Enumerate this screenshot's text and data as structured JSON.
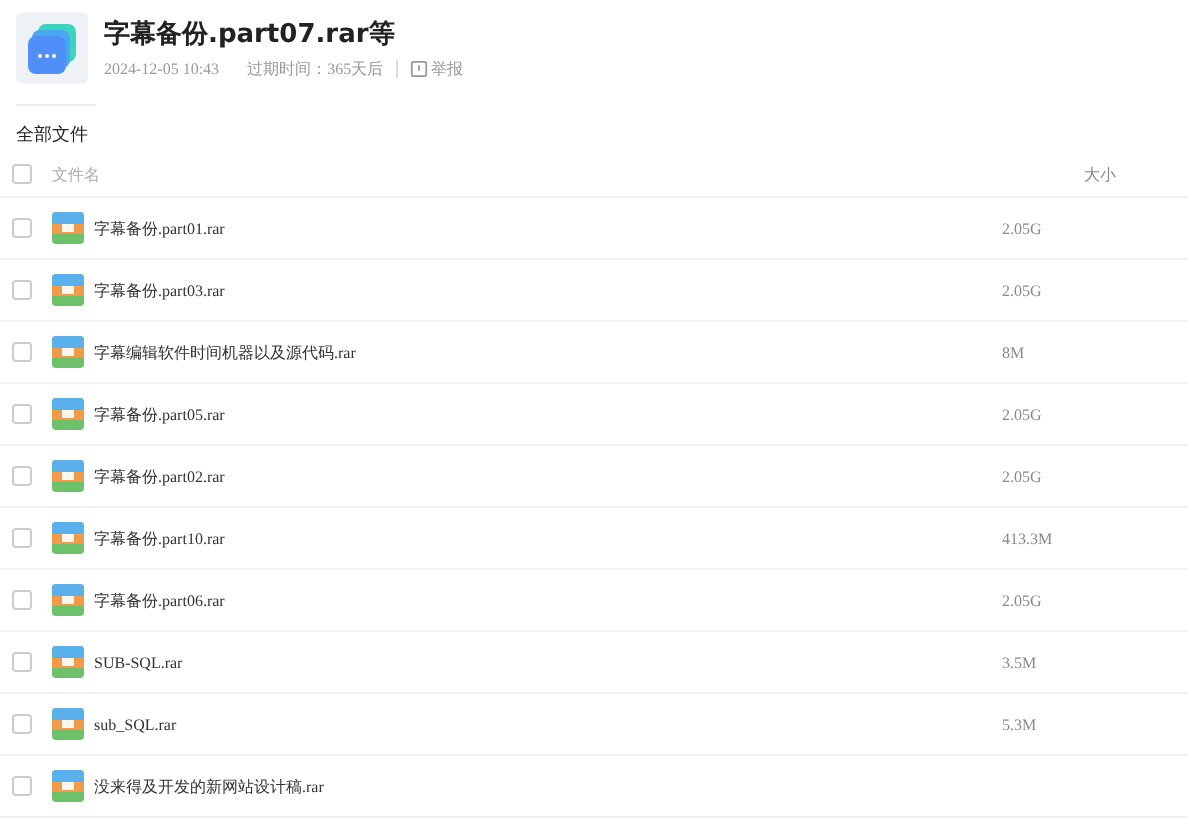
{
  "share": {
    "title": "字幕备份.part07.rar等",
    "date": "2024-12-05 10:43",
    "expiry": "过期时间：365天后",
    "report": "举报"
  },
  "breadcrumb": "全部文件",
  "table": {
    "columns": [
      "文件名",
      "大小"
    ],
    "header_checked": false,
    "rows": [
      {
        "name": "字幕备份.part01.rar",
        "size": "2.05G",
        "checked": false
      },
      {
        "name": "字幕备份.part03.rar",
        "size": "2.05G",
        "checked": false
      },
      {
        "name": "字幕编辑软件时间机器以及源代码.rar",
        "size": "8M",
        "checked": false
      },
      {
        "name": "字幕备份.part05.rar",
        "size": "2.05G",
        "checked": false
      },
      {
        "name": "字幕备份.part02.rar",
        "size": "2.05G",
        "checked": false
      },
      {
        "name": "字幕备份.part10.rar",
        "size": "413.3M",
        "checked": false
      },
      {
        "name": "字幕备份.part06.rar",
        "size": "2.05G",
        "checked": false
      },
      {
        "name": "SUB-SQL.rar",
        "size": "3.5M",
        "checked": false
      },
      {
        "name": "sub_SQL.rar",
        "size": "5.3M",
        "checked": false
      },
      {
        "name": "没来得及开发的新网站设计稿.rar",
        "checked": false
      }
    ]
  }
}
